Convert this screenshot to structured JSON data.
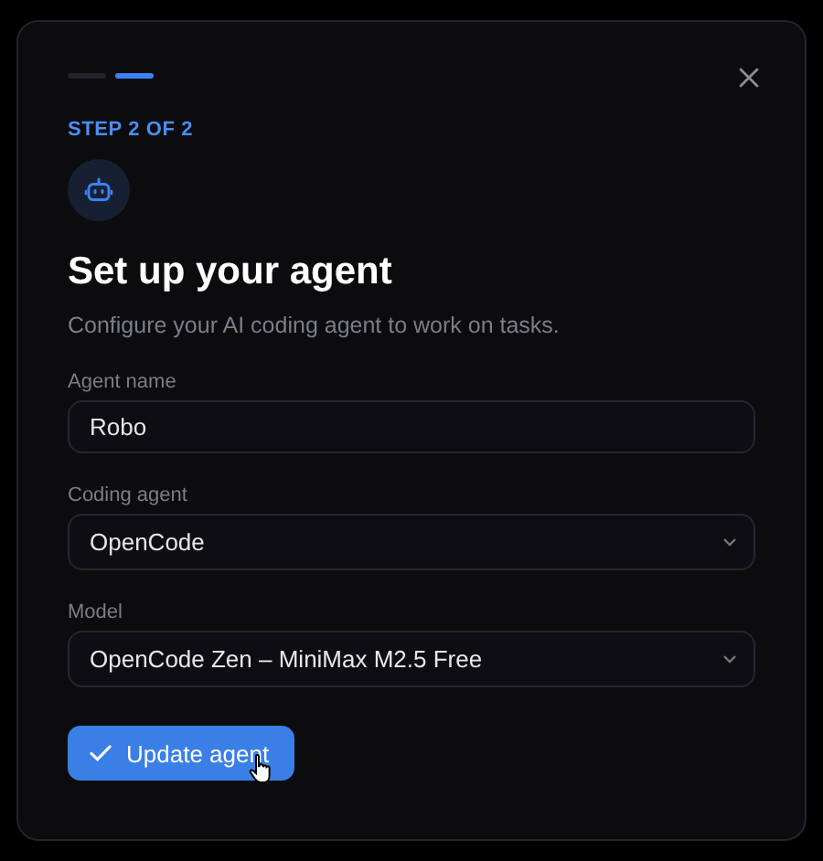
{
  "steps": [
    {
      "selected": false
    },
    {
      "selected": true
    }
  ],
  "step_label": "STEP 2 OF 2",
  "title": "Set up your agent",
  "subtitle": "Configure your AI coding agent to work on tasks.",
  "fields": [
    {
      "kind": "text",
      "label": "Agent name",
      "value": "Robo"
    },
    {
      "kind": "select",
      "label": "Coding agent",
      "value": "OpenCode"
    },
    {
      "kind": "select",
      "label": "Model",
      "value": "OpenCode Zen – MiniMax M2.5 Free"
    }
  ],
  "submit": {
    "label": "Update agent"
  }
}
